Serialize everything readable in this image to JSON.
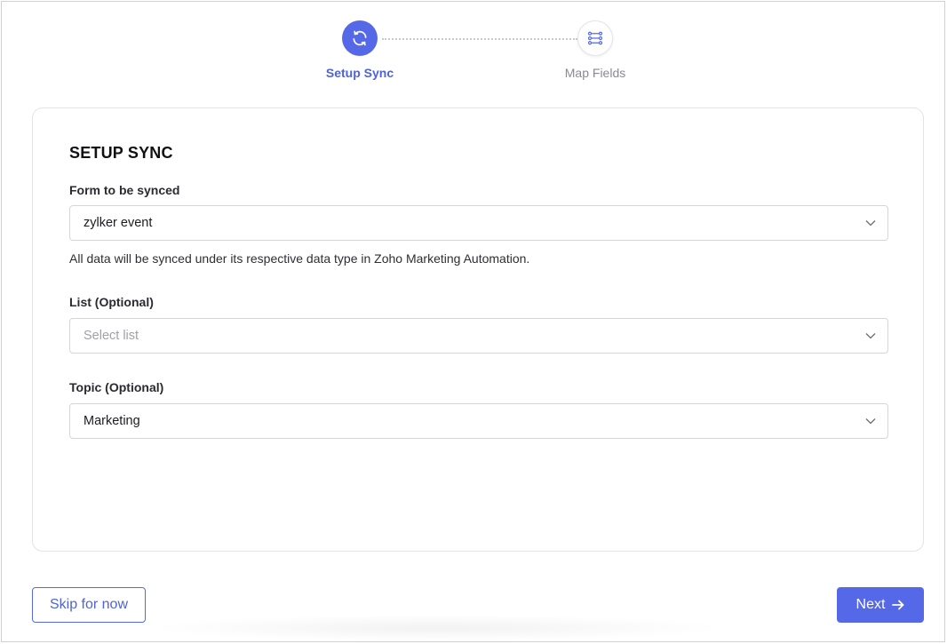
{
  "stepper": {
    "steps": [
      {
        "label": "Setup Sync",
        "state": "active",
        "icon": "sync-icon"
      },
      {
        "label": "Map Fields",
        "state": "inactive",
        "icon": "map-fields-icon"
      }
    ]
  },
  "card": {
    "title": "SETUP SYNC",
    "form_field": {
      "label": "Form to be synced",
      "value": "zylker event",
      "helper": "All data will be synced under its respective data type in Zoho Marketing Automation."
    },
    "list_field": {
      "label": "List (Optional)",
      "placeholder": "Select list"
    },
    "topic_field": {
      "label": "Topic (Optional)",
      "value": "Marketing"
    }
  },
  "footer": {
    "skip_label": "Skip for now",
    "next_label": "Next"
  },
  "colors": {
    "accent": "#5569e8",
    "accent_text": "#4e63d9",
    "inactive_text": "#8a8a92"
  }
}
